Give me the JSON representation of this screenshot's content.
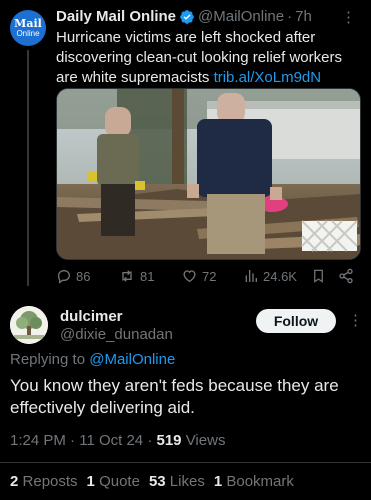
{
  "tweet": {
    "avatar": {
      "line1": "Mail",
      "line2": "Online"
    },
    "display_name": "Daily Mail Online",
    "handle": "@MailOnline",
    "dot": "·",
    "time": "7h",
    "more": "⋮",
    "text": "Hurricane victims are left shocked after discovering clean-cut looking relief workers are white supremacists ",
    "link": "trib.al/XoLm9dN",
    "actions": {
      "replies": "86",
      "reposts": "81",
      "likes": "72",
      "views": "24.6K"
    }
  },
  "reply": {
    "display_name": "dulcimer",
    "handle": "@dixie_dunadan",
    "follow_label": "Follow",
    "more": "⋮",
    "replying_prefix": "Replying to ",
    "replying_to": "@MailOnline",
    "text": "You know they aren't feds because they are effectively delivering aid.",
    "time": "1:24 PM",
    "date": "11 Oct 24",
    "views_count": "519",
    "views_label": "Views",
    "sep": " · ",
    "stats": [
      {
        "count": "2",
        "label": "Reposts"
      },
      {
        "count": "1",
        "label": "Quote"
      },
      {
        "count": "53",
        "label": "Likes"
      },
      {
        "count": "1",
        "label": "Bookmark"
      }
    ]
  },
  "colors": {
    "background": "#000000",
    "text": "#e7e9ea",
    "secondary": "#71767b",
    "link": "#1d9bf0",
    "mail_brand": "#1d6fd1"
  }
}
